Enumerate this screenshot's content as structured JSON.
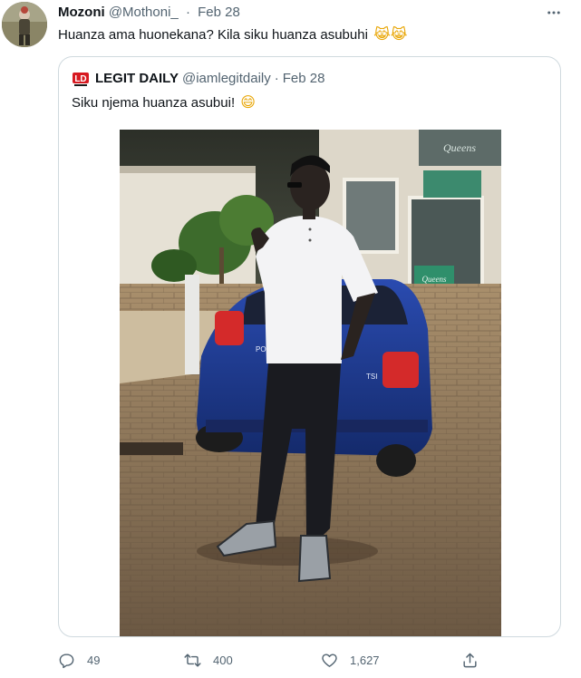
{
  "author": {
    "display_name": "Mozoni",
    "handle": "@Mothoni_",
    "separator": "·",
    "date": "Feb 28"
  },
  "tweet": {
    "text": "Huanza ama huonekana? Kila siku huanza asubuhi",
    "emojis": "😹😹"
  },
  "quoted": {
    "display_name": "LEGIT DAILY",
    "handle": "@iamlegitdaily",
    "separator": "·",
    "date": "Feb 28",
    "text": "Siku njema huanza asubui!",
    "emoji": "😄",
    "logo_text": "LD",
    "image": {
      "storefront_sign": "Queens",
      "car_badge": "POLO",
      "car_badge_2": "TSI"
    }
  },
  "actions": {
    "replies": "49",
    "retweets": "400",
    "likes": "1,627"
  },
  "icons": {
    "more": "more-horizontal-icon",
    "reply": "reply-icon",
    "retweet": "retweet-icon",
    "like": "heart-icon",
    "share": "share-icon"
  },
  "colors": {
    "text_primary": "#0f1419",
    "text_secondary": "#536471",
    "border": "#cfd9de",
    "car_blue": "#1e3a8f"
  }
}
